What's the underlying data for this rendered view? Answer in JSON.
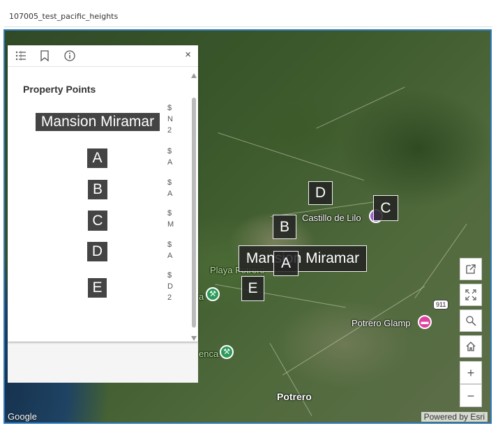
{
  "window": {
    "title": "107005_test_pacific_heights"
  },
  "panel": {
    "layer_title": "Property Points",
    "close_glyph": "×",
    "legend": [
      {
        "symbol": "Mansion Miramar",
        "label": "$\nN\n2"
      },
      {
        "symbol": "A",
        "label": "$\nA"
      },
      {
        "symbol": "B",
        "label": "$\nA"
      },
      {
        "symbol": "C",
        "label": "$\nM"
      },
      {
        "symbol": "D",
        "label": "$\nA"
      },
      {
        "symbol": "E",
        "label": "$\nD\n2"
      }
    ]
  },
  "map": {
    "markers": [
      {
        "label": "D"
      },
      {
        "label": "C"
      },
      {
        "label": "B"
      },
      {
        "label": "Mansion Miramar"
      },
      {
        "label": "A"
      },
      {
        "label": "E"
      }
    ],
    "places": {
      "castillo": "Castillo de Lilo",
      "playa": "Playa Potrero",
      "glamp": "Potrero Glamp",
      "potrero": "Potrero",
      "partial_a": "a",
      "partial_enca": "enca",
      "route": "911"
    },
    "attribution": {
      "provider": "Google",
      "powered": "Powered by Esri"
    },
    "tools": {
      "zoom_in": "+",
      "zoom_out": "−"
    }
  }
}
